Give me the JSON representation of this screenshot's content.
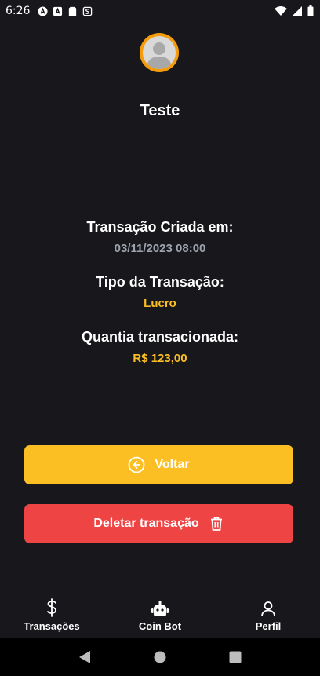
{
  "status_bar": {
    "time": "6:26"
  },
  "profile": {
    "name": "Teste"
  },
  "transaction": {
    "created_label": "Transação Criada em:",
    "created_value": "03/11/2023 08:00",
    "type_label": "Tipo da Transação:",
    "type_value": "Lucro",
    "amount_label": "Quantia transacionada:",
    "amount_value": "R$ 123,00"
  },
  "buttons": {
    "back_label": "Voltar",
    "delete_label": "Deletar transação"
  },
  "bottom_nav": {
    "items": [
      {
        "label": "Transações",
        "icon": "dollar-icon"
      },
      {
        "label": "Coin Bot",
        "icon": "robot-icon"
      },
      {
        "label": "Perfil",
        "icon": "person-icon"
      }
    ]
  },
  "colors": {
    "background": "#18171c",
    "accent": "#fbbf24",
    "danger": "#ef4444",
    "muted": "#9ca3af"
  }
}
